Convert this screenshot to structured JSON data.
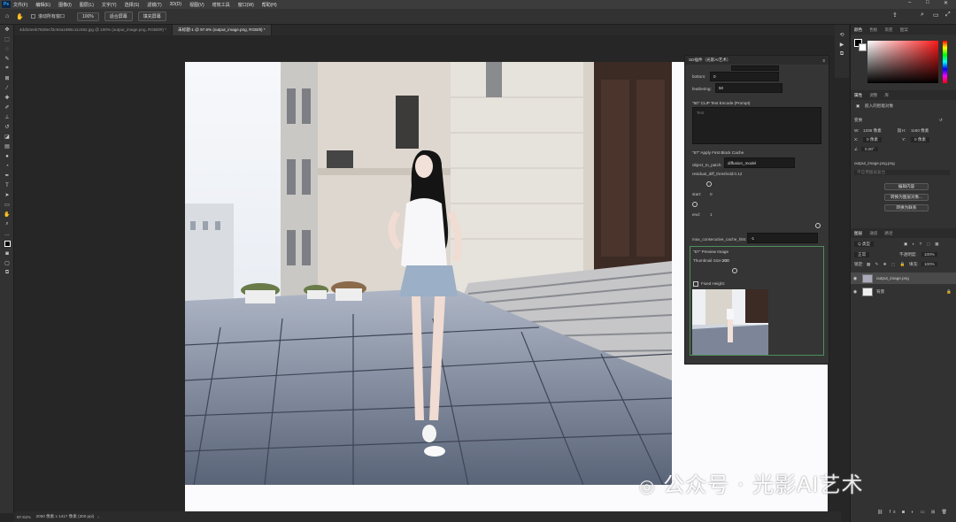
{
  "app": {
    "logo": "Ps"
  },
  "menubar": {
    "items": [
      "文件(F)",
      "编辑(E)",
      "图像(I)",
      "图层(L)",
      "文字(Y)",
      "选择(S)",
      "滤镜(T)",
      "3D(D)",
      "视图(V)",
      "增效工具",
      "窗口(W)",
      "帮助(H)"
    ]
  },
  "options": {
    "scroll_all": "滚动所有窗口",
    "zoom": "100%",
    "fit_screen": "适合屏幕",
    "fill_screen": "填充屏幕"
  },
  "tabs": [
    {
      "label": "4dd34eeb7828ecf3c94a1686c11c052.jpg @ 100% (output_image.png, RGB/8#) *",
      "active": false
    },
    {
      "label": "未标题-1 @ 97.6% (output_image.png, RGB/8) *",
      "active": true
    }
  ],
  "status": {
    "zoom": "97.61%",
    "doc_info": "2050 像素 x 1417 像素 (300 ppi)"
  },
  "sd_panel": {
    "title": "SD插件（光影AI艺术）",
    "bottom_label": "bottom:",
    "bottom_value": "0",
    "feathering_label": "feathering:",
    "feathering_value": "50",
    "clip_title": "\"60\" CLIP Text Encode (Prompt)",
    "clip_placeholder": "Text",
    "cache_title": "\"67\" Apply First Block Cache",
    "object_to_patch_label": "object_to_patch:",
    "object_to_patch_value": "diffusion_model",
    "residual_label": "residual_diff_threshold:0.12",
    "start_label": "start:",
    "start_value": "0",
    "end_label": "end:",
    "end_value": "1",
    "max_cache_label": "max_consecutive_cache_hits:",
    "max_cache_value": "-1",
    "preview_title": "\"67\" Preview Image",
    "thumb_size_label": "Thumbnail Size:",
    "thumb_size_value": "200",
    "fixed_height_label": "Fixed Height:"
  },
  "right_dock": {
    "color_tabs": [
      "颜色",
      "色板",
      "渐变",
      "图案"
    ],
    "props_tabs": [
      "属性",
      "调整",
      "库"
    ],
    "smart_obj_label": "嵌入的智能对象",
    "transform_label": "变换",
    "w_label": "W:",
    "w_value": "1336 像素",
    "h_label": "H:",
    "h_value": "1160 像素",
    "x_label": "X:",
    "x_value": "0 像素",
    "y_label": "Y:",
    "y_value": "0 像素",
    "angle_value": "0.00°",
    "file_name": "output_image.png.png",
    "layer_comp_placeholder": "不应用图层复合",
    "btn_edit": "编辑内容",
    "btn_convert_layer": "转换为图层对象...",
    "btn_convert_linked": "转换为联系",
    "layers_tabs": [
      "图层",
      "通道",
      "路径"
    ],
    "filter_kind": "Q 类型",
    "blend_mode": "正常",
    "opacity_label": "不透明度:",
    "opacity_value": "100%",
    "lock_label": "锁定:",
    "fill_label": "填充:",
    "fill_value": "100%",
    "layers": [
      {
        "name": "output_image.png",
        "active": true
      },
      {
        "name": "背景",
        "active": false
      }
    ]
  },
  "watermark": "公众号 · 光影AI艺术"
}
